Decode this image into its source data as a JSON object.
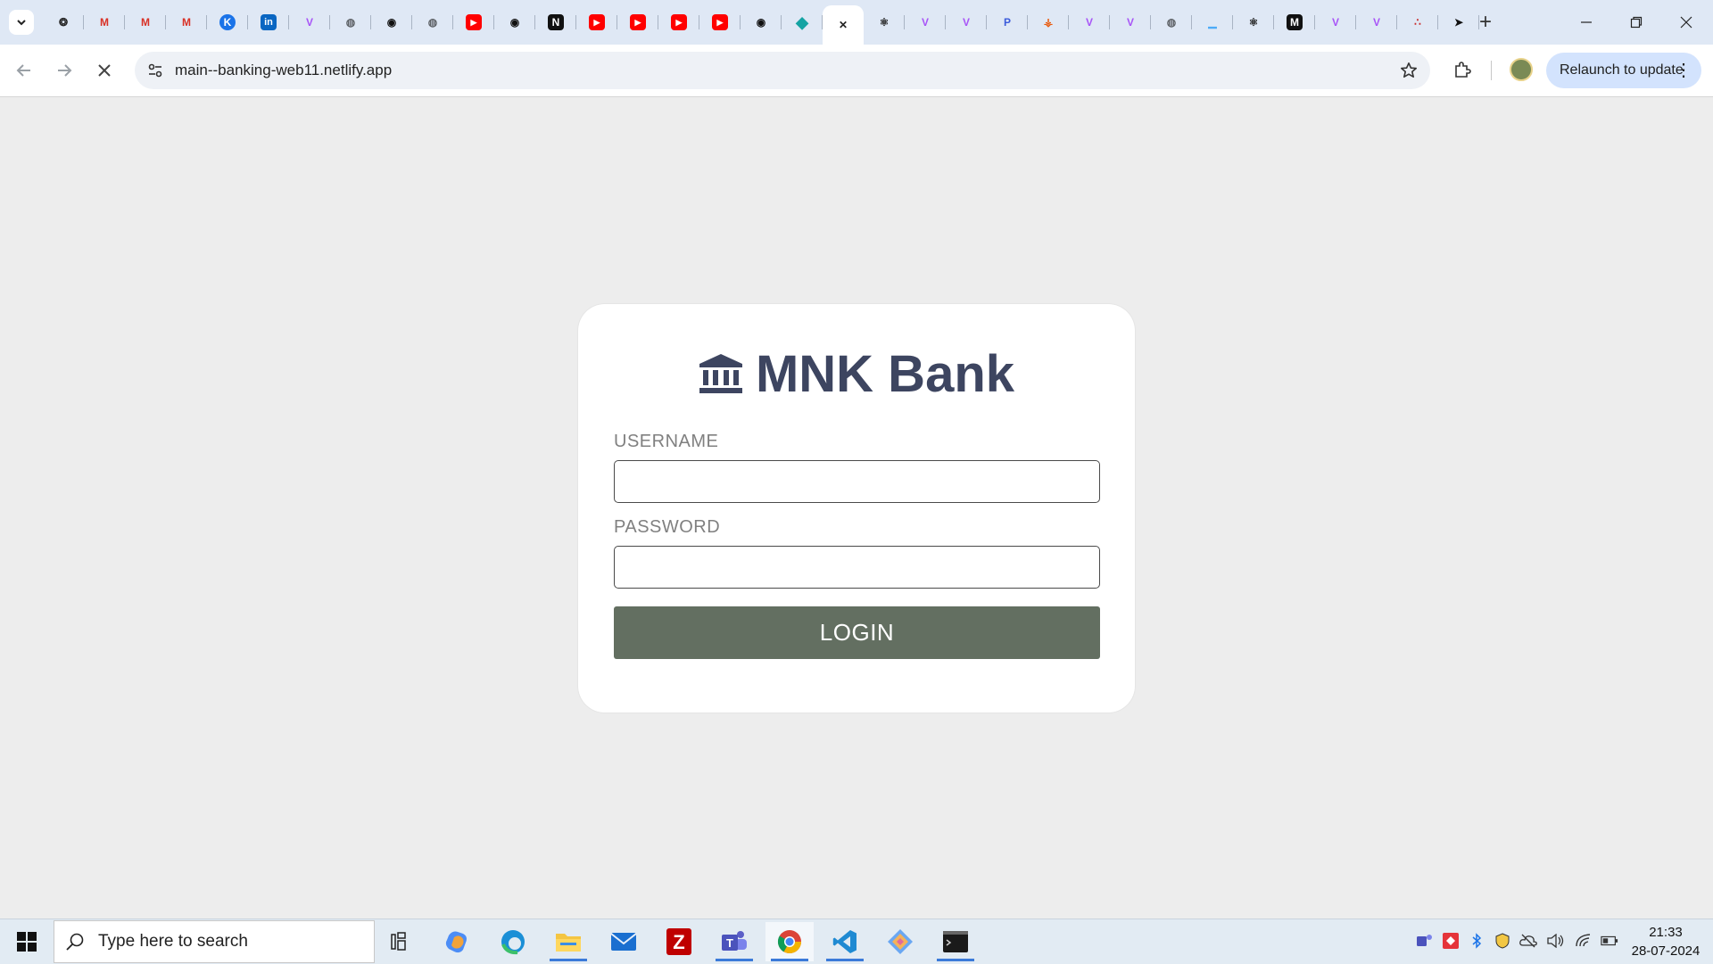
{
  "browser": {
    "url": "main--banking-web11.netlify.app",
    "relaunch_label": "Relaunch to update",
    "tabs": [
      {
        "icon": "openai-icon",
        "color": "#222222",
        "glyph": "❂"
      },
      {
        "icon": "gmail-icon",
        "color": "#d93025",
        "glyph": "M"
      },
      {
        "icon": "gmail-icon",
        "color": "#d93025",
        "glyph": "M"
      },
      {
        "icon": "gmail-icon",
        "color": "#d93025",
        "glyph": "M"
      },
      {
        "icon": "k-icon",
        "color": "#1a73e8",
        "glyph": "K"
      },
      {
        "icon": "linkedin-icon",
        "color": "#0a66c2",
        "glyph": "in"
      },
      {
        "icon": "vite-icon",
        "color": "#a855f7",
        "glyph": "V"
      },
      {
        "icon": "globe-icon",
        "color": "#5f6368",
        "glyph": "◍"
      },
      {
        "icon": "github-icon",
        "color": "#111111",
        "glyph": "◉"
      },
      {
        "icon": "globe-icon",
        "color": "#5f6368",
        "glyph": "◍"
      },
      {
        "icon": "youtube-icon",
        "color": "#ff0000",
        "glyph": "▶"
      },
      {
        "icon": "github-icon",
        "color": "#111111",
        "glyph": "◉"
      },
      {
        "icon": "notion-icon",
        "color": "#111111",
        "glyph": "N"
      },
      {
        "icon": "youtube-icon",
        "color": "#ff0000",
        "glyph": "▶"
      },
      {
        "icon": "youtube-icon",
        "color": "#ff0000",
        "glyph": "▶"
      },
      {
        "icon": "youtube-icon",
        "color": "#ff0000",
        "glyph": "▶"
      },
      {
        "icon": "youtube-icon",
        "color": "#ff0000",
        "glyph": "▶"
      },
      {
        "icon": "github-icon",
        "color": "#111111",
        "glyph": "◉"
      },
      {
        "icon": "netlify-icon",
        "color": "#14a3a3",
        "glyph": "◆"
      },
      {
        "icon": "close-icon",
        "color": "#222222",
        "glyph": "✕",
        "active": true
      },
      {
        "icon": "react-icon",
        "color": "#222222",
        "glyph": "⚛"
      },
      {
        "icon": "vite-icon",
        "color": "#a855f7",
        "glyph": "V"
      },
      {
        "icon": "vite-icon",
        "color": "#a855f7",
        "glyph": "V"
      },
      {
        "icon": "p-icon",
        "color": "#3b5bdb",
        "glyph": "P"
      },
      {
        "icon": "orange-icon",
        "color": "#e8590c",
        "glyph": "⚶"
      },
      {
        "icon": "vite-icon",
        "color": "#a855f7",
        "glyph": "V"
      },
      {
        "icon": "vite-icon",
        "color": "#a855f7",
        "glyph": "V"
      },
      {
        "icon": "globe-icon",
        "color": "#5f6368",
        "glyph": "◍"
      },
      {
        "icon": "chart-icon",
        "color": "#4dabf7",
        "glyph": "▁"
      },
      {
        "icon": "react-icon",
        "color": "#222222",
        "glyph": "⚛"
      },
      {
        "icon": "m-icon",
        "color": "#111111",
        "glyph": "M"
      },
      {
        "icon": "vite-icon",
        "color": "#a855f7",
        "glyph": "V"
      },
      {
        "icon": "vite-icon",
        "color": "#a855f7",
        "glyph": "V"
      },
      {
        "icon": "dots-icon",
        "color": "#c92a2a",
        "glyph": "∴"
      },
      {
        "icon": "send-icon",
        "color": "#111111",
        "glyph": "➤"
      }
    ]
  },
  "login": {
    "brand_name": "MNK Bank",
    "username_label": "USERNAME",
    "username_value": "",
    "password_label": "PASSWORD",
    "password_value": "",
    "login_label": "LOGIN"
  },
  "taskbar": {
    "search_placeholder": "Type here to search",
    "time": "21:33",
    "date": "28-07-2024"
  },
  "colors": {
    "page_bg": "#ededed",
    "brand": "#3d4560",
    "login_button": "#636f61"
  }
}
